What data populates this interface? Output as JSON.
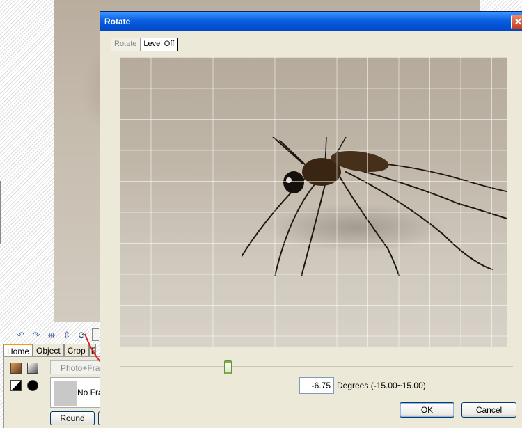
{
  "background_app": {
    "tabs": [
      "Home",
      "Object",
      "Crop",
      "R"
    ],
    "photo_frame_button": "Photo+Frame",
    "frame_label": "No Frame",
    "round_button": "Round",
    "toolbar_icons": [
      "undo-icon",
      "redo-icon",
      "flip-horizontal-icon",
      "flip-vertical-icon",
      "rotate-icon"
    ],
    "colors": {
      "tab_highlight": "#f0a000",
      "photo": "#c6bcae"
    }
  },
  "dialog": {
    "title": "Rotate",
    "tabs": [
      {
        "label": "Rotate",
        "active": false
      },
      {
        "label": "Level Off",
        "active": true
      }
    ],
    "degree_value": "-6.75",
    "degree_label": "Degrees (-15.00~15.00)",
    "slider_fraction": 0.275,
    "buttons": {
      "ok": "OK",
      "cancel": "Cancel"
    },
    "colors": {
      "titlebar": "#0a5fe0",
      "close_button": "#c63c1f",
      "dialog_bg": "#ece9d8"
    }
  },
  "annotation": {
    "color": "#e02020",
    "shape": "curved-arrow"
  }
}
